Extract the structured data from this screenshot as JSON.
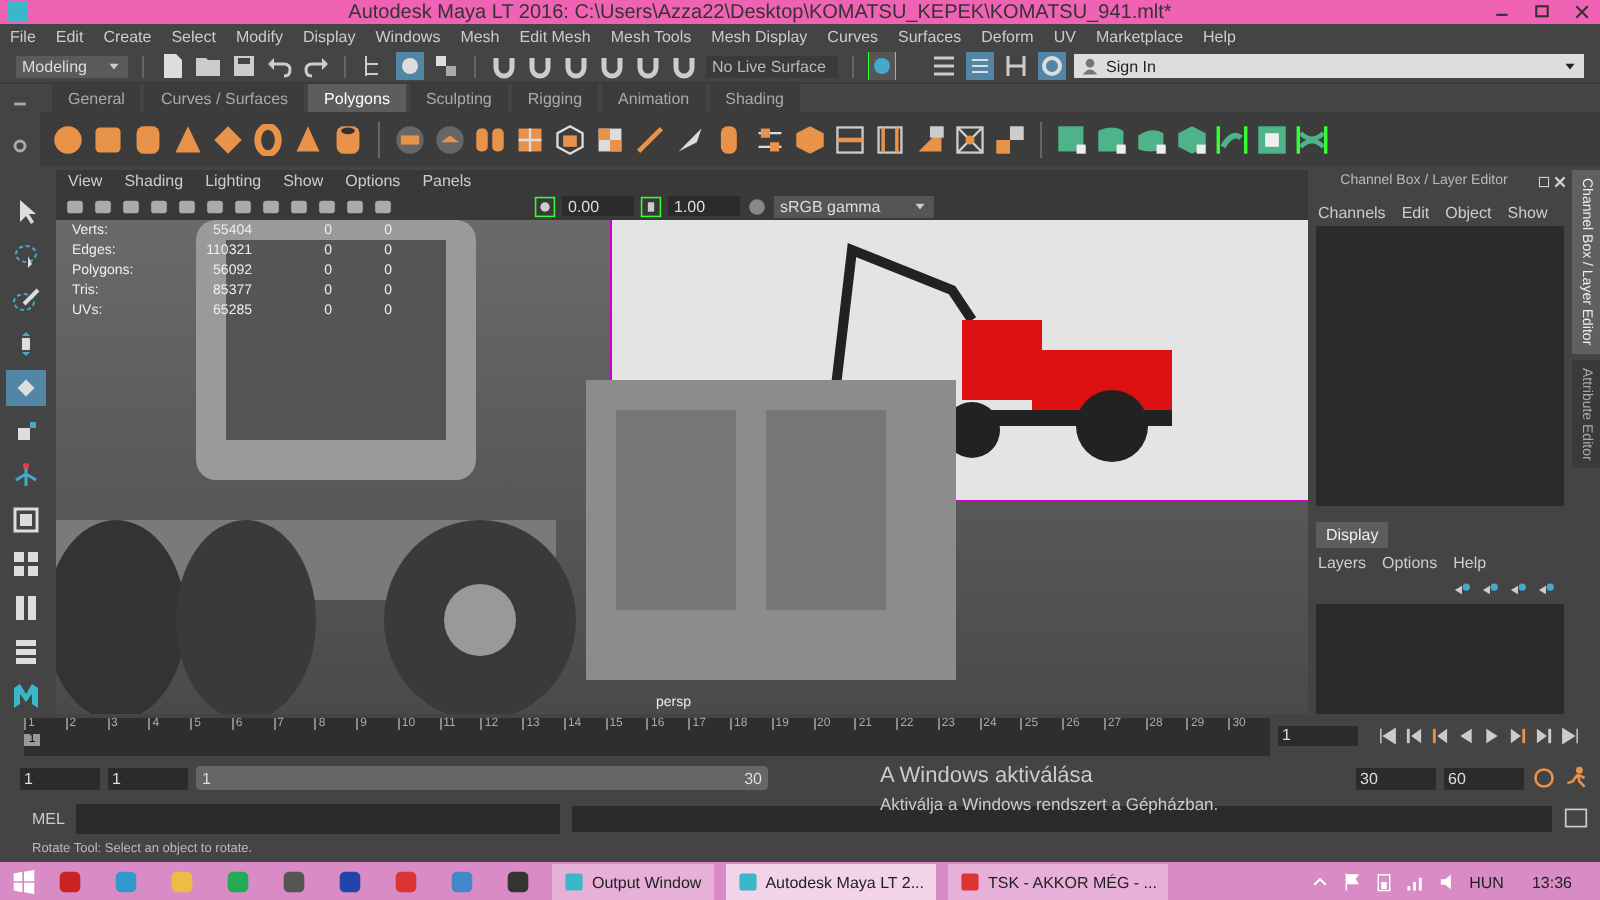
{
  "window": {
    "title": "Autodesk Maya LT 2016: C:\\Users\\Azza22\\Desktop\\KOMATSU_KEPEK\\KOMATSU_941.mlt*"
  },
  "menu_bar": [
    "File",
    "Edit",
    "Create",
    "Select",
    "Modify",
    "Display",
    "Windows",
    "Mesh",
    "Edit Mesh",
    "Mesh Tools",
    "Mesh Display",
    "Curves",
    "Surfaces",
    "Deform",
    "UV",
    "Marketplace",
    "Help"
  ],
  "status_line": {
    "mode": "Modeling",
    "live_surface": "No Live Surface",
    "sign_in": "Sign In"
  },
  "shelf": {
    "tabs": [
      {
        "label": "General",
        "selected": false
      },
      {
        "label": "Curves / Surfaces",
        "selected": false
      },
      {
        "label": "Polygons",
        "selected": true
      },
      {
        "label": "Sculpting",
        "selected": false
      },
      {
        "label": "Rigging",
        "selected": false
      },
      {
        "label": "Animation",
        "selected": false
      },
      {
        "label": "Shading",
        "selected": false
      }
    ]
  },
  "viewport": {
    "menu": [
      "View",
      "Shading",
      "Lighting",
      "Show",
      "Options",
      "Panels"
    ],
    "exposure": "0.00",
    "gamma": "1.00",
    "color_space": "sRGB gamma",
    "hud": [
      {
        "label": "Verts:",
        "values": [
          "55404",
          "0",
          "0"
        ]
      },
      {
        "label": "Edges:",
        "values": [
          "110321",
          "0",
          "0"
        ]
      },
      {
        "label": "Polygons:",
        "values": [
          "56092",
          "0",
          "0"
        ]
      },
      {
        "label": "Tris:",
        "values": [
          "85377",
          "0",
          "0"
        ]
      },
      {
        "label": "UVs:",
        "values": [
          "65285",
          "0",
          "0"
        ]
      }
    ],
    "camera": "persp"
  },
  "channel_box": {
    "title": "Channel Box / Layer Editor",
    "menu": [
      "Channels",
      "Edit",
      "Object",
      "Show"
    ],
    "layer_tabs": [
      {
        "label": "Display",
        "selected": true
      }
    ],
    "layer_menu": [
      "Layers",
      "Options",
      "Help"
    ]
  },
  "side_tabs": [
    {
      "label": "Channel Box / Layer Editor",
      "selected": true
    },
    {
      "label": "Attribute Editor",
      "selected": false
    }
  ],
  "time_slider": {
    "ticks": [
      "1",
      "2",
      "3",
      "4",
      "5",
      "6",
      "7",
      "8",
      "9",
      "10",
      "11",
      "12",
      "13",
      "14",
      "15",
      "16",
      "17",
      "18",
      "19",
      "20",
      "21",
      "22",
      "23",
      "24",
      "25",
      "26",
      "27",
      "28",
      "29",
      "30"
    ],
    "current_marker": "1",
    "level": 0,
    "current_frame": "1"
  },
  "range_slider": {
    "start": "1",
    "playback_start": "1",
    "range_start": "1",
    "range_end": "30",
    "playback_end": "30",
    "end": "60",
    "level": 1
  },
  "command_line": {
    "language": "MEL"
  },
  "help_line": "Rotate Tool: Select an object to rotate.",
  "activation_notice": {
    "title": "A Windows aktiválása",
    "message": "Aktiválja a Windows rendszert a Gépházban."
  },
  "taskbar": {
    "buttons": [
      {
        "label": "Output Window",
        "selected": false
      },
      {
        "label": "Autodesk Maya LT 2...",
        "selected": true
      },
      {
        "label": "TSK - AKKOR MÉG - ...",
        "selected": false
      }
    ],
    "language": "HUN",
    "clock": "13:36"
  }
}
